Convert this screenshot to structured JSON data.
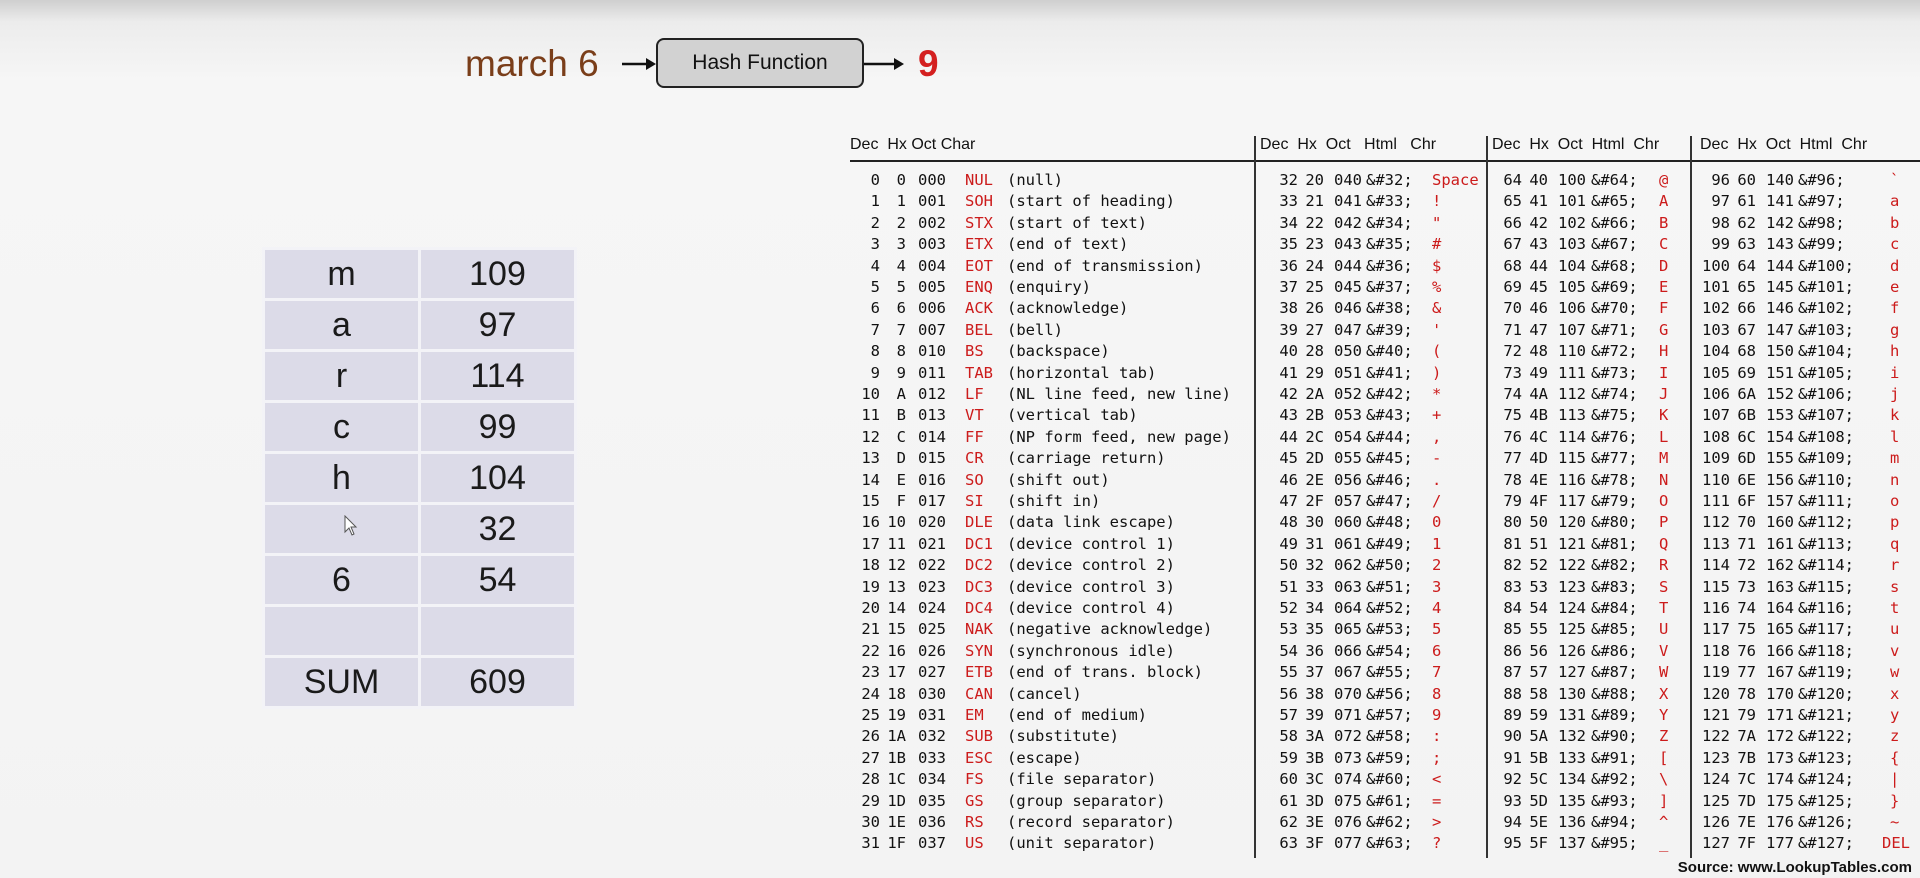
{
  "diagram": {
    "input": "march 6",
    "function_label": "Hash Function",
    "output": "9"
  },
  "char_table": [
    {
      "char": "m",
      "code": "109"
    },
    {
      "char": "a",
      "code": "97"
    },
    {
      "char": "r",
      "code": "114"
    },
    {
      "char": "c",
      "code": "99"
    },
    {
      "char": "h",
      "code": "104"
    },
    {
      "char": "",
      "code": "32"
    },
    {
      "char": "6",
      "code": "54"
    },
    {
      "char": "",
      "code": ""
    },
    {
      "char": "SUM",
      "code": "609"
    }
  ],
  "ascii_table": {
    "headers": [
      [
        "Dec",
        "Hx",
        "Oct",
        "Char"
      ],
      [
        "Dec",
        "Hx",
        "Oct",
        "Html",
        "Chr"
      ],
      [
        "Dec",
        "Hx",
        "Oct",
        "Html",
        "Chr"
      ],
      [
        "Dec",
        "Hx",
        "Oct",
        "Html",
        "Chr"
      ]
    ],
    "control_chars": [
      [
        "NUL",
        "(null)"
      ],
      [
        "SOH",
        "(start of heading)"
      ],
      [
        "STX",
        "(start of text)"
      ],
      [
        "ETX",
        "(end of text)"
      ],
      [
        "EOT",
        "(end of transmission)"
      ],
      [
        "ENQ",
        "(enquiry)"
      ],
      [
        "ACK",
        "(acknowledge)"
      ],
      [
        "BEL",
        "(bell)"
      ],
      [
        "BS",
        "(backspace)"
      ],
      [
        "TAB",
        "(horizontal tab)"
      ],
      [
        "LF",
        "(NL line feed, new line)"
      ],
      [
        "VT",
        "(vertical tab)"
      ],
      [
        "FF",
        "(NP form feed, new page)"
      ],
      [
        "CR",
        "(carriage return)"
      ],
      [
        "SO",
        "(shift out)"
      ],
      [
        "SI",
        "(shift in)"
      ],
      [
        "DLE",
        "(data link escape)"
      ],
      [
        "DC1",
        "(device control 1)"
      ],
      [
        "DC2",
        "(device control 2)"
      ],
      [
        "DC3",
        "(device control 3)"
      ],
      [
        "DC4",
        "(device control 4)"
      ],
      [
        "NAK",
        "(negative acknowledge)"
      ],
      [
        "SYN",
        "(synchronous idle)"
      ],
      [
        "ETB",
        "(end of trans. block)"
      ],
      [
        "CAN",
        "(cancel)"
      ],
      [
        "EM",
        "(end of medium)"
      ],
      [
        "SUB",
        "(substitute)"
      ],
      [
        "ESC",
        "(escape)"
      ],
      [
        "FS",
        "(file separator)"
      ],
      [
        "GS",
        "(group separator)"
      ],
      [
        "RS",
        "(record separator)"
      ],
      [
        "US",
        "(unit separator)"
      ]
    ],
    "chr2": [
      "Space",
      "!",
      "\"",
      "#",
      "$",
      "%",
      "&",
      "'",
      "(",
      ")",
      "*",
      "+",
      ",",
      "-",
      ".",
      "/",
      "0",
      "1",
      "2",
      "3",
      "4",
      "5",
      "6",
      "7",
      "8",
      "9",
      ":",
      ";",
      "<",
      "=",
      ">",
      "?"
    ],
    "chr3": [
      "@",
      "A",
      "B",
      "C",
      "D",
      "E",
      "F",
      "G",
      "H",
      "I",
      "J",
      "K",
      "L",
      "M",
      "N",
      "O",
      "P",
      "Q",
      "R",
      "S",
      "T",
      "U",
      "V",
      "W",
      "X",
      "Y",
      "Z",
      "[",
      "\\",
      "]",
      "^",
      "_"
    ],
    "chr4": [
      "`",
      "a",
      "b",
      "c",
      "d",
      "e",
      "f",
      "g",
      "h",
      "i",
      "j",
      "k",
      "l",
      "m",
      "n",
      "o",
      "p",
      "q",
      "r",
      "s",
      "t",
      "u",
      "v",
      "w",
      "x",
      "y",
      "z",
      "{",
      "|",
      "}",
      "~",
      "DEL"
    ],
    "source": "Source:  www.LookupTables.com"
  }
}
